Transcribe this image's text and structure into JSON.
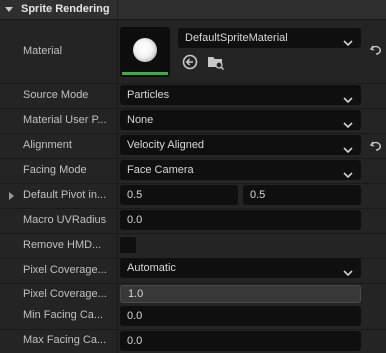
{
  "section": {
    "title": "Sprite Rendering"
  },
  "material": {
    "label": "Material",
    "value": "DefaultSpriteMaterial"
  },
  "source_mode": {
    "label": "Source Mode",
    "value": "Particles"
  },
  "material_user_param": {
    "label": "Material User P...",
    "value": "None"
  },
  "alignment": {
    "label": "Alignment",
    "value": "Velocity Aligned"
  },
  "facing_mode": {
    "label": "Facing Mode",
    "value": "Face Camera"
  },
  "default_pivot": {
    "label": "Default Pivot in...",
    "x": "0.5",
    "y": "0.5"
  },
  "macro_uv_radius": {
    "label": "Macro UVRadius",
    "value": "0.0"
  },
  "remove_hmd": {
    "label": "Remove HMD...",
    "checked": false
  },
  "pixel_coverage_mode": {
    "label": "Pixel Coverage...",
    "value": "Automatic"
  },
  "pixel_coverage_blend": {
    "label": "Pixel Coverage...",
    "value": "1.0"
  },
  "min_facing_camera": {
    "label": "Min Facing Ca...",
    "value": "0.0"
  },
  "max_facing_camera": {
    "label": "Max Facing Ca...",
    "value": "0.0"
  },
  "colors": {
    "accent_green": "#3fae47",
    "field_bg": "#0f0f0f",
    "row_bg": "#242424"
  }
}
